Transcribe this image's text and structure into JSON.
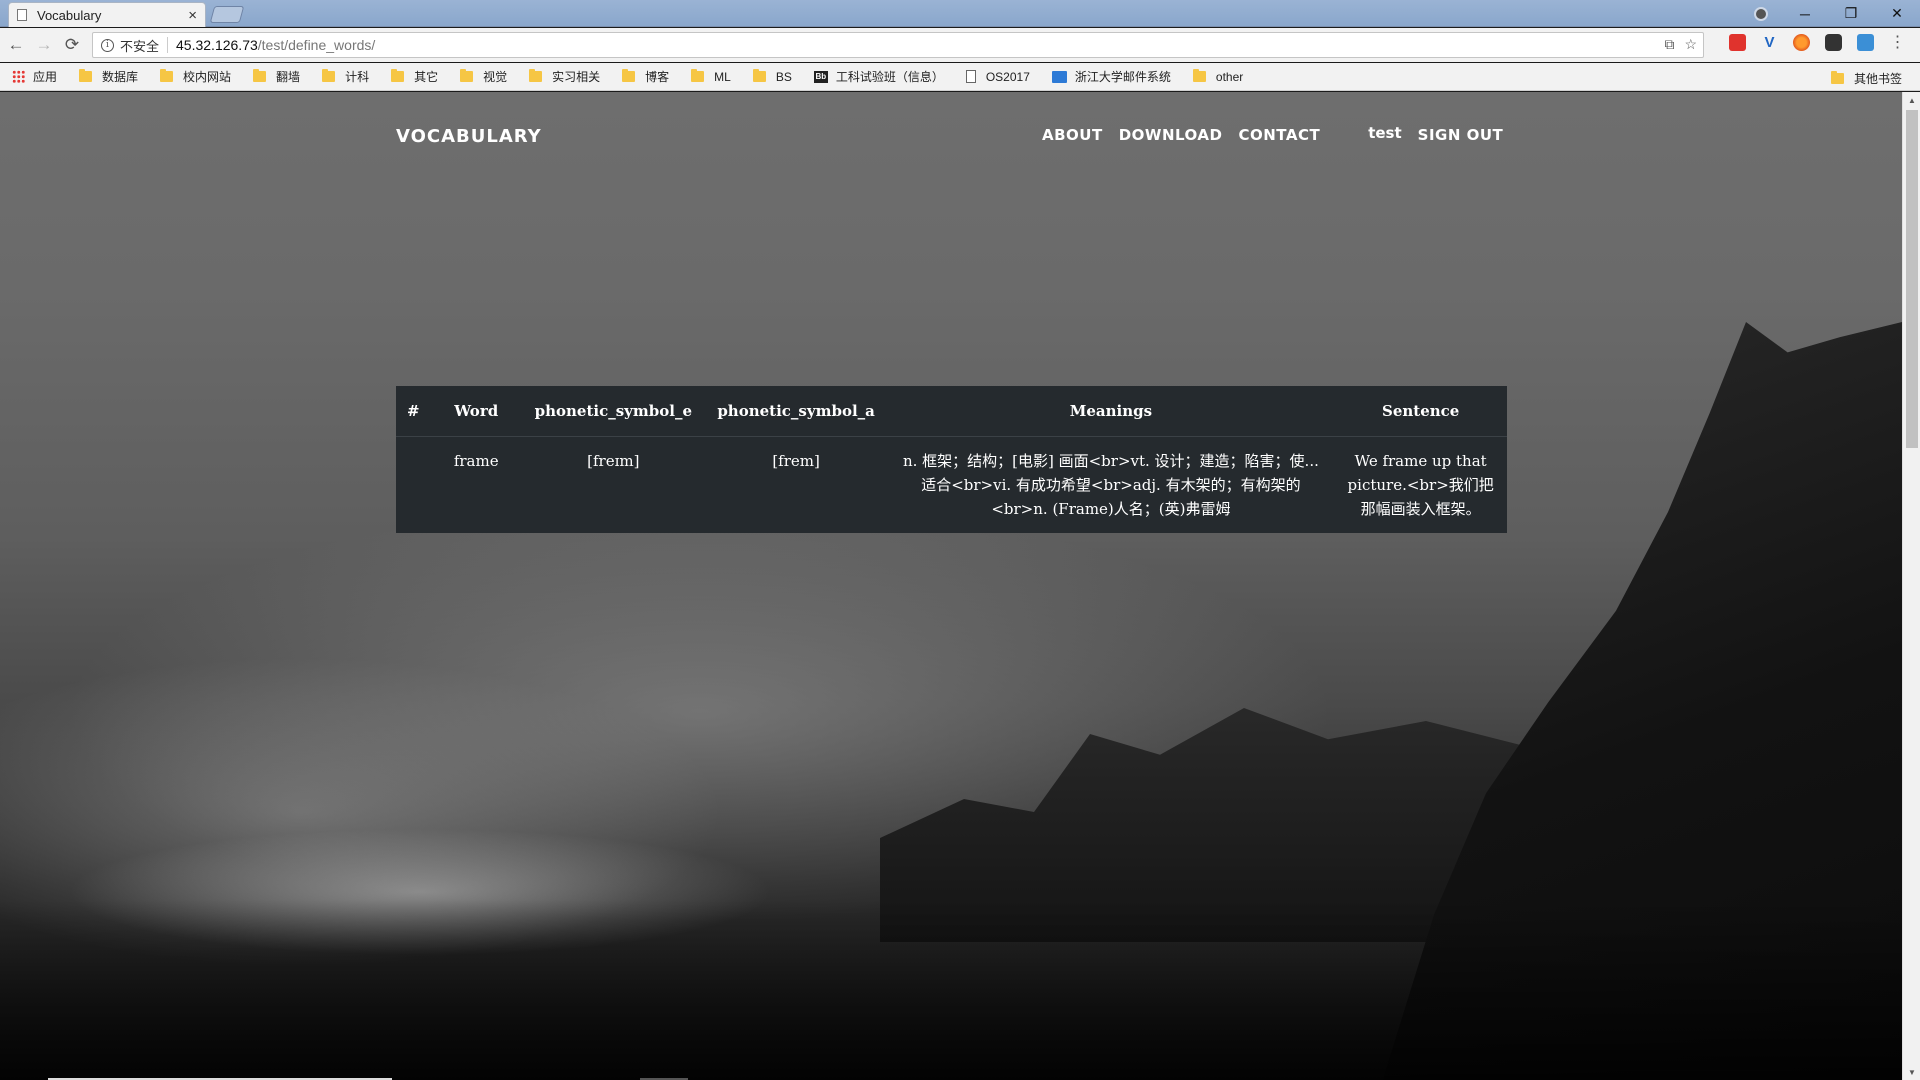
{
  "browser": {
    "tab_title": "Vocabulary",
    "tab_close": "×",
    "window_controls": {
      "minimize": "─",
      "restore": "❐",
      "close": "✕"
    },
    "security_label": "不安全",
    "url_host": "45.32.126.73",
    "url_path": "/test/define_words/",
    "nav_icons": {
      "back": "←",
      "forward": "→",
      "reload": "⟳"
    },
    "bookmarks": [
      {
        "label": "应用",
        "icon": "apps-icon"
      },
      {
        "label": "数据库",
        "icon": "folder-icon"
      },
      {
        "label": "校内网站",
        "icon": "folder-icon"
      },
      {
        "label": "翻墙",
        "icon": "folder-icon"
      },
      {
        "label": "计科",
        "icon": "folder-icon"
      },
      {
        "label": "其它",
        "icon": "folder-icon"
      },
      {
        "label": "视觉",
        "icon": "folder-icon"
      },
      {
        "label": "实习相关",
        "icon": "folder-icon"
      },
      {
        "label": "博客",
        "icon": "folder-icon"
      },
      {
        "label": "ML",
        "icon": "folder-icon"
      },
      {
        "label": "BS",
        "icon": "folder-icon"
      },
      {
        "label": "工科试验班（信息）",
        "icon": "bb-icon"
      },
      {
        "label": "OS2017",
        "icon": "page-icon"
      },
      {
        "label": "浙江大学邮件系统",
        "icon": "mail-icon"
      },
      {
        "label": "other",
        "icon": "folder-icon"
      }
    ],
    "other_bookmarks": "其他书签"
  },
  "site": {
    "brand": "VOCABULARY",
    "nav": {
      "about": "ABOUT",
      "download": "DOWNLOAD",
      "contact": "CONTACT"
    },
    "user": "test",
    "sign_out": "SIGN OUT"
  },
  "table": {
    "headers": [
      "#",
      "Word",
      "phonetic_symbol_e",
      "phonetic_symbol_a",
      "Meanings",
      "Sentence"
    ],
    "rows": [
      {
        "index": "",
        "word": "frame",
        "phonetic_e": "[freɪm]",
        "phonetic_a": "[frem]",
        "meanings": "n. 框架；结构；[电影] 画面<br>vt. 设计；建造；陷害；使...适合<br>vi. 有成功希望<br>adj. 有木架的；有构架的<br>n. (Frame)人名；(英)弗雷姆",
        "sentence": "We frame up that picture.<br>我们把那幅画装入框架。"
      }
    ]
  }
}
